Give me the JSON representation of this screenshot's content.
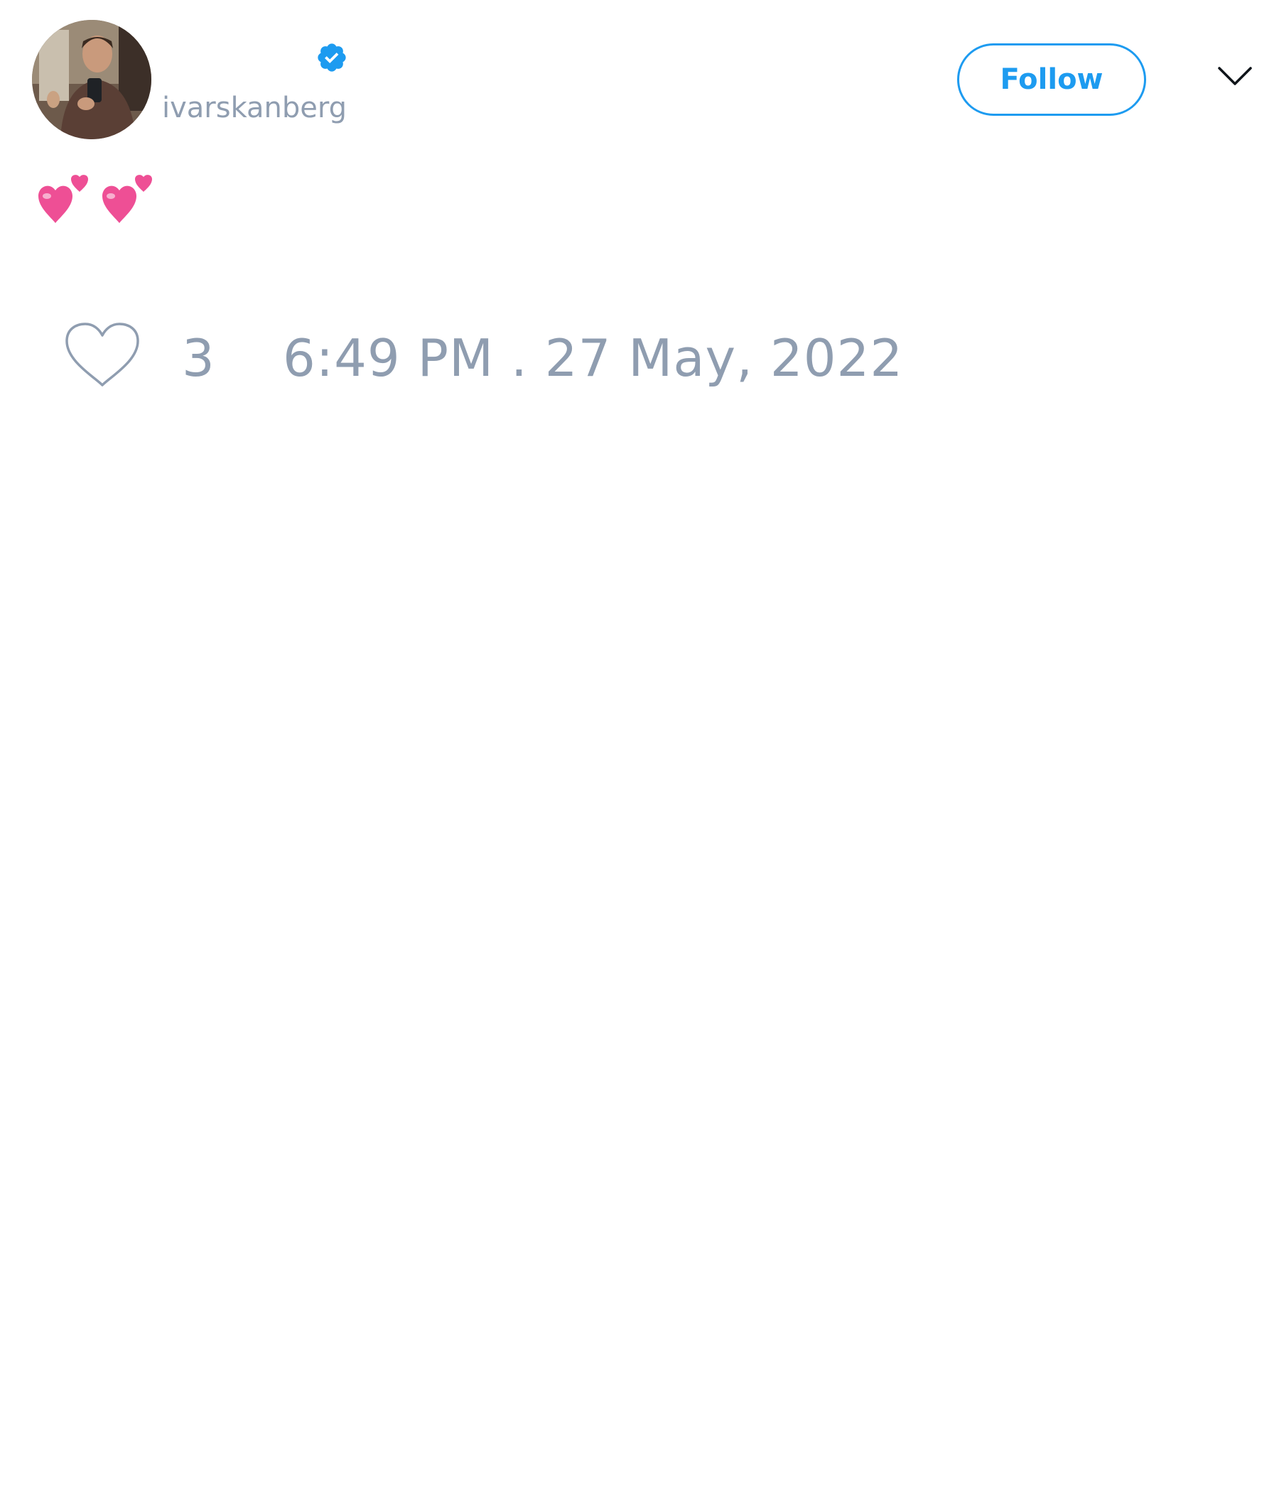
{
  "tweet": {
    "author": {
      "display_name": "",
      "username": "ivarskanberg",
      "verified": true,
      "avatar_icon": "profile-photo"
    },
    "follow_label": "Follow",
    "menu_icon": "chevron-down-icon",
    "text_icons": [
      "two-hearts-emoji",
      "two-hearts-emoji"
    ],
    "likes": {
      "icon": "heart-outline-icon",
      "count": "3"
    },
    "timestamp": "6:49 PM . 27 May, 2022"
  },
  "colors": {
    "accent": "#1d9bf0",
    "muted_text": "#8f9db0",
    "emoji_pink": "#ee4f95"
  }
}
